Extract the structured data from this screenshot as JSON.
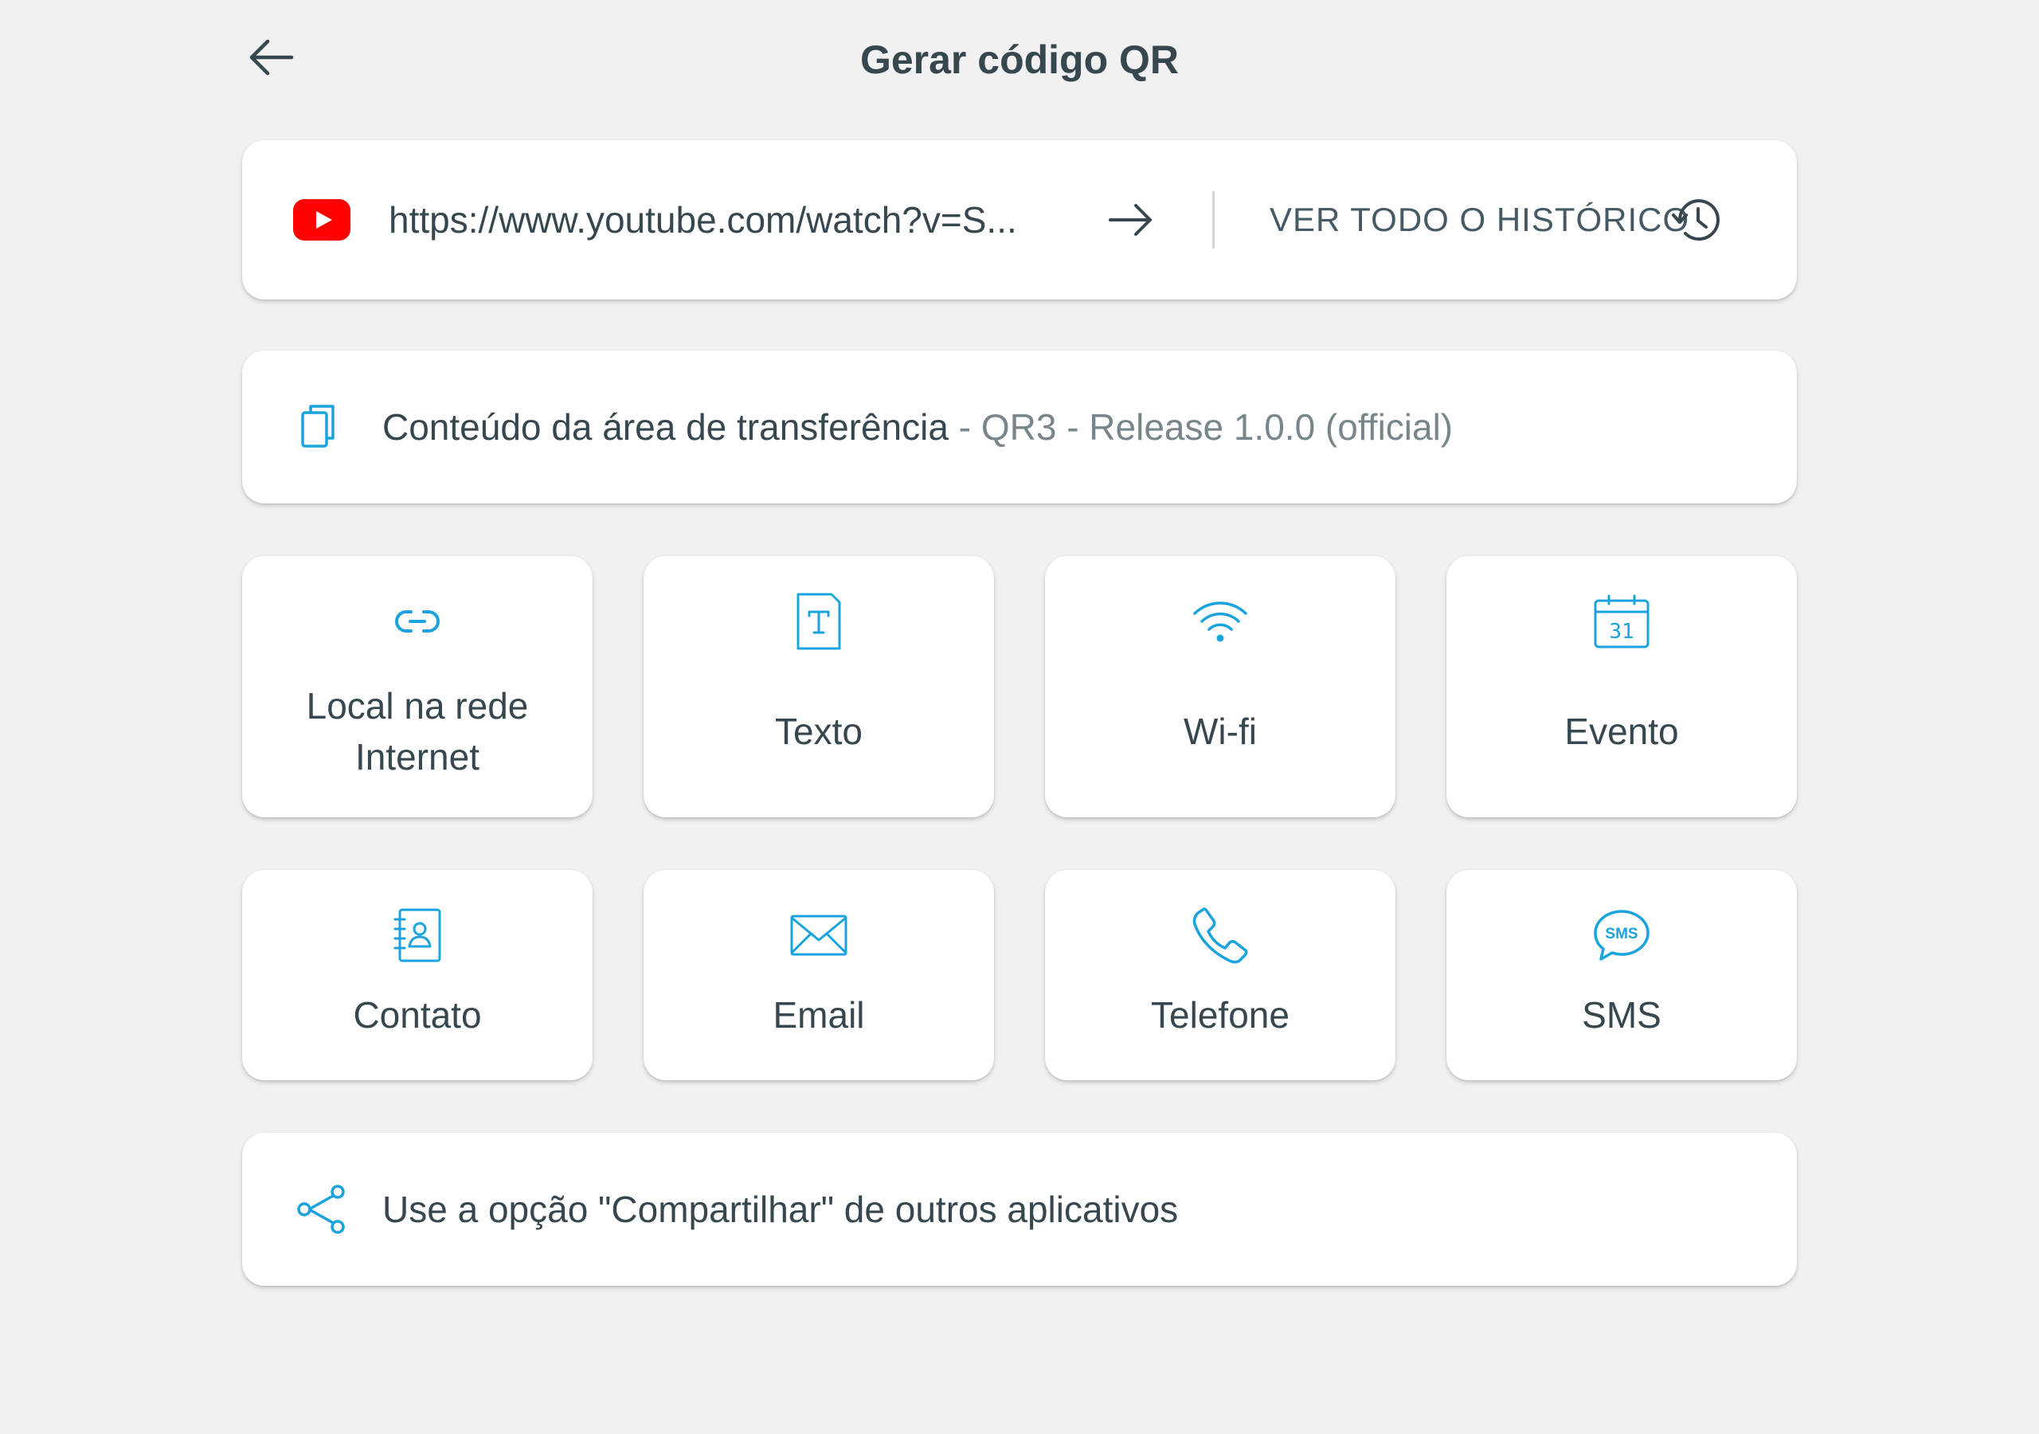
{
  "header": {
    "title": "Gerar código QR",
    "back_icon": "arrow-left-icon"
  },
  "history": {
    "url": "https://www.youtube.com/watch?v=S...",
    "source_icon": "youtube-icon",
    "open_icon": "arrow-right-icon",
    "view_all_label": "VER TODO O HISTÓRICO",
    "history_icon": "history-icon"
  },
  "clipboard": {
    "icon": "clipboard-copy-icon",
    "label": "Conteúdo da área de transferência",
    "separator": " - ",
    "content": "QR3 - Release 1.0.0 (official)"
  },
  "types": [
    {
      "label": "Local na rede Internet",
      "icon": "link-icon"
    },
    {
      "label": "Texto",
      "icon": "text-document-icon"
    },
    {
      "label": "Wi-fi",
      "icon": "wifi-icon"
    },
    {
      "label": "Evento",
      "icon": "calendar-icon",
      "icon_text": "31"
    },
    {
      "label": "Contato",
      "icon": "contact-book-icon"
    },
    {
      "label": "Email",
      "icon": "envelope-icon"
    },
    {
      "label": "Telefone",
      "icon": "phone-icon"
    },
    {
      "label": "SMS",
      "icon": "sms-bubble-icon",
      "icon_text": "SMS"
    }
  ],
  "share": {
    "icon": "share-icon",
    "label": "Use a opção \"Compartilhar\" de outros aplicativos"
  },
  "colors": {
    "accent": "#1aa3dc",
    "youtube_red": "#ff0000",
    "text": "#37474f",
    "muted": "#78868c",
    "background": "#f1f1f1"
  }
}
